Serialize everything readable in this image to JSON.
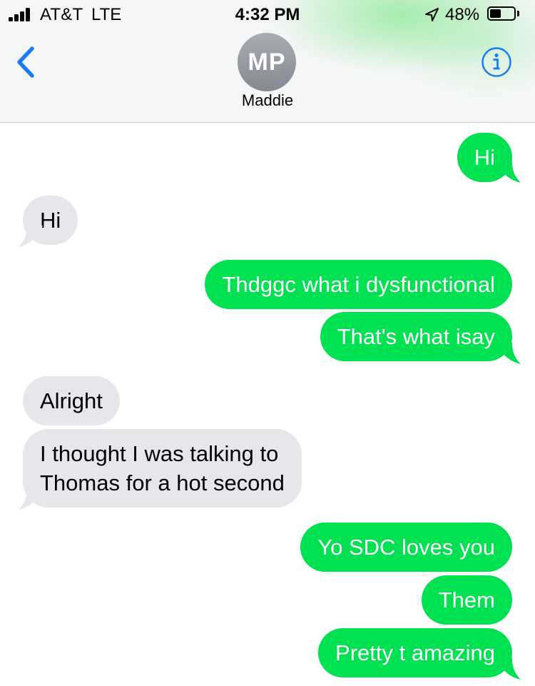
{
  "status_bar": {
    "carrier": "AT&T",
    "network": "LTE",
    "time": "4:32 PM",
    "battery_percent": "48%",
    "battery_level": 0.48,
    "signal_bars": 4
  },
  "header": {
    "avatar_initials": "MP",
    "contact_name": "Maddie"
  },
  "colors": {
    "sent_bubble": "#00e151",
    "received_bubble": "#e6e6eb",
    "accent": "#1a7cf5"
  },
  "icons": {
    "back": "chevron-left-icon",
    "info": "info-circle-icon",
    "location": "location-arrow-icon"
  },
  "messages": [
    {
      "direction": "sent",
      "text": "Hi"
    },
    {
      "direction": "received",
      "text": "Hi"
    },
    {
      "direction": "sent",
      "text": "Thdggc what i dysfunctional"
    },
    {
      "direction": "sent",
      "text": "That's what isay"
    },
    {
      "direction": "received",
      "text": "Alright"
    },
    {
      "direction": "received",
      "text": "I thought I was talking to\nThomas for a hot second"
    },
    {
      "direction": "sent",
      "text": "Yo SDC loves you"
    },
    {
      "direction": "sent",
      "text": "Them"
    },
    {
      "direction": "sent",
      "text": "Pretty t amazing"
    }
  ]
}
